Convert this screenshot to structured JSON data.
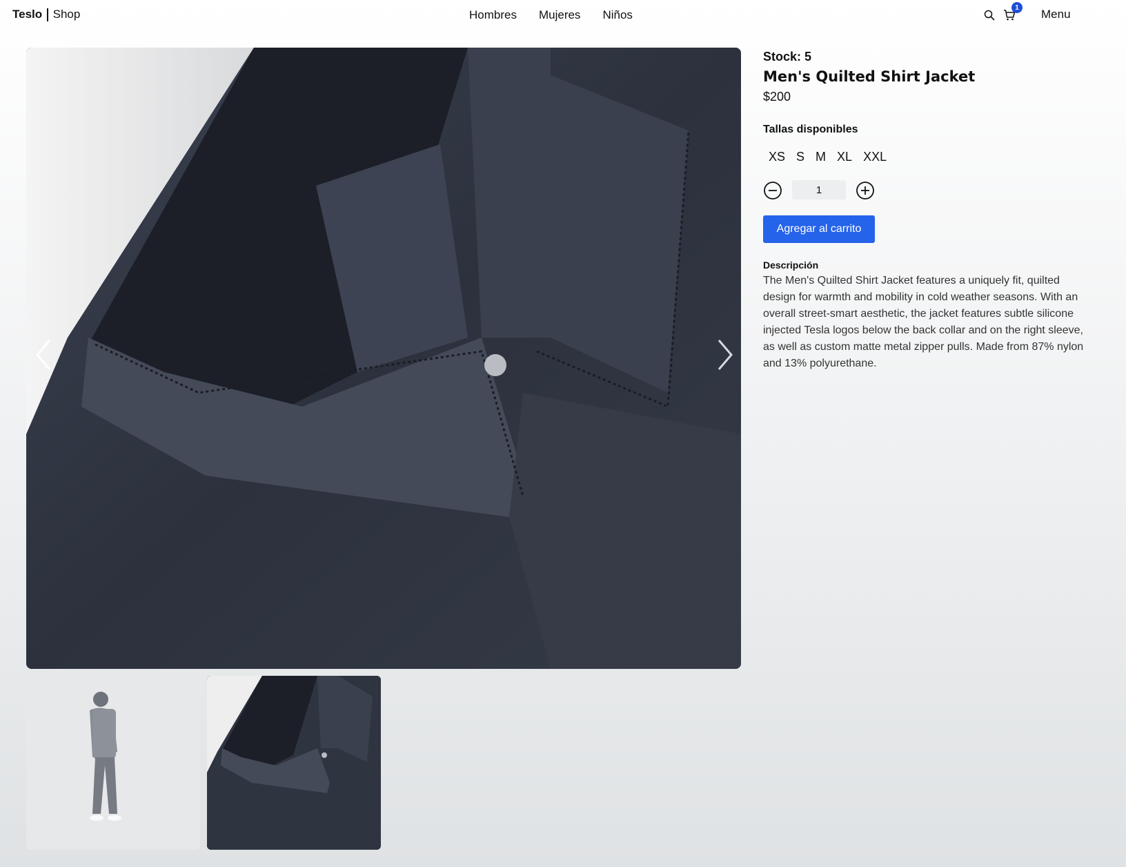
{
  "nav": {
    "brand_bold": "Teslo",
    "brand_light": "Shop",
    "links": [
      "Hombres",
      "Mujeres",
      "Niños"
    ],
    "cart_count": "1",
    "menu_label": "Menu",
    "search_icon": "search-icon",
    "cart_icon": "cart-icon"
  },
  "product": {
    "stock": "Stock: 5",
    "title": "Men's Quilted Shirt Jacket",
    "price": "$200",
    "sizes_label": "Tallas disponibles",
    "sizes": [
      "XS",
      "S",
      "M",
      "XL",
      "XXL"
    ],
    "quantity": "1",
    "add_to_cart": "Agregar al carrito",
    "description_label": "Descripción",
    "description": "The Men's Quilted Shirt Jacket features a uniquely fit, quilted design for warmth and mobility in cold weather seasons. With an overall street-smart aesthetic, the jacket features subtle silicone injected Tesla logos below the back collar and on the right sleeve, as well as custom matte metal zipper pulls. Made from 87% nylon and 13% polyurethane."
  },
  "colors": {
    "accent": "#2563eb",
    "badge": "#1d4ed8",
    "jacket": "#2f3441"
  }
}
